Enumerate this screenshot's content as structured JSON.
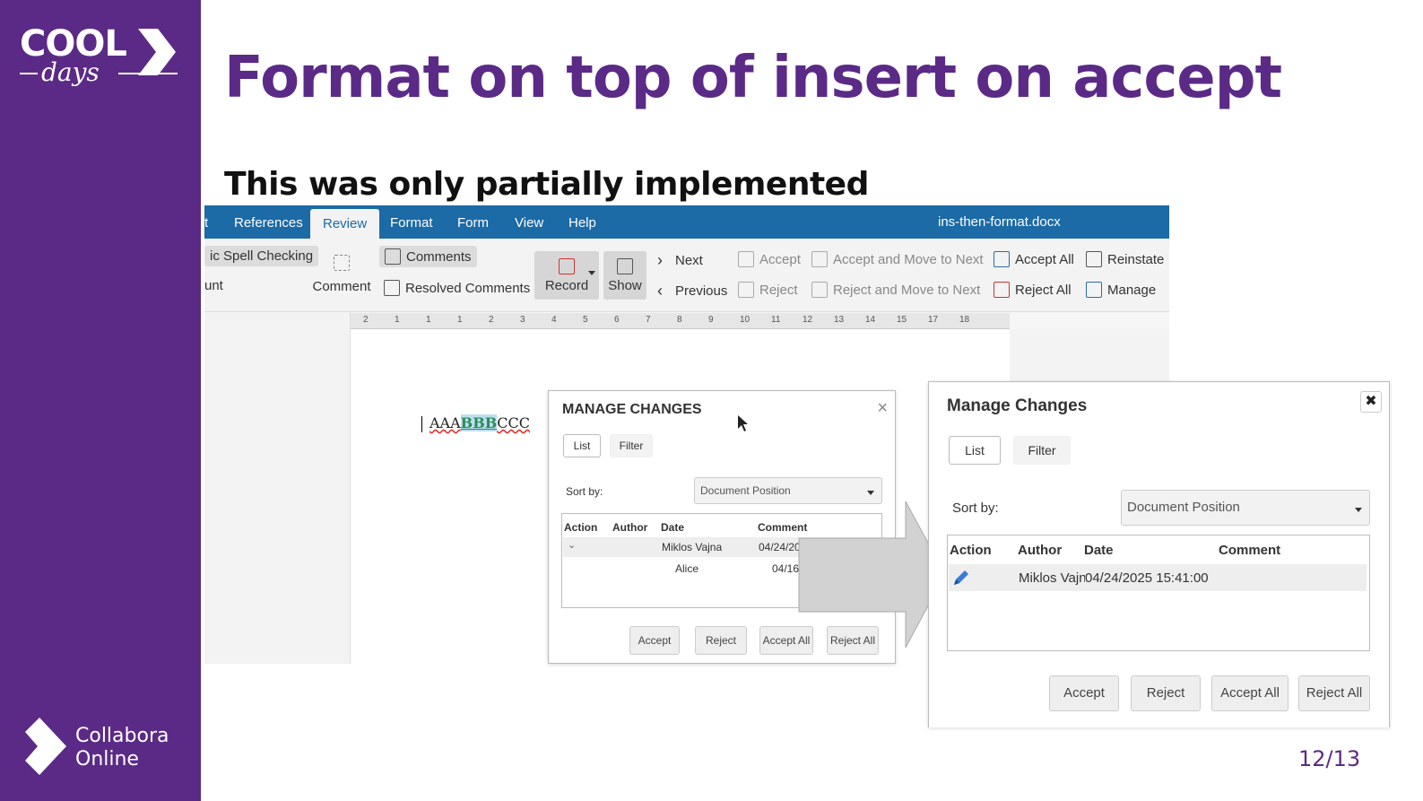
{
  "slide": {
    "title": "Format on top of insert on accept",
    "subtitle": "This was only partially implemented",
    "page_number": "12/13"
  },
  "branding": {
    "cool_logo_top": "COOL",
    "cool_logo_bottom": "days",
    "collabora_logo": "Collabora\nOnline"
  },
  "colors": {
    "purple": "#5b2a86",
    "tab_blue": "#1c6aa6"
  },
  "app": {
    "tabs": [
      "t",
      "References",
      "Review",
      "Format",
      "Form",
      "View",
      "Help"
    ],
    "active_tab": "Review",
    "document_name": "ins-then-format.docx",
    "ribbon": {
      "spell_checking": "ic Spell Checking",
      "word_count": "unt",
      "comment": "Comment",
      "comments": "Comments",
      "resolved_comments": "Resolved Comments",
      "record": "Record",
      "show": "Show",
      "next": "Next",
      "previous": "Previous",
      "accept": "Accept",
      "reject": "Reject",
      "accept_and_move": "Accept and Move to Next",
      "reject_and_move": "Reject and Move to Next",
      "accept_all": "Accept All",
      "reject_all": "Reject All",
      "reinstate": "Reinstate",
      "manage": "Manage"
    },
    "ruler_ticks": [
      "2",
      "1",
      "1",
      "1",
      "2",
      "3",
      "4",
      "5",
      "6",
      "7",
      "8",
      "9",
      "10",
      "11",
      "12",
      "13",
      "14",
      "15",
      "17",
      "18"
    ],
    "document_text": {
      "before": "AAA",
      "changed": "BBB",
      "after": "CCC"
    }
  },
  "dialog_small": {
    "title": "MANAGE CHANGES",
    "tab_list": "List",
    "tab_filter": "Filter",
    "sort_label": "Sort by:",
    "sort_value": "Document Position",
    "columns": [
      "Action",
      "Author",
      "Date",
      "Comment"
    ],
    "rows": [
      {
        "author": "Miklos Vajna",
        "date": "04/24/202"
      },
      {
        "author": "Alice",
        "date": "04/16/"
      }
    ],
    "buttons": [
      "Accept",
      "Reject",
      "Accept All",
      "Reject All"
    ]
  },
  "dialog_large": {
    "title": "Manage Changes",
    "tab_list": "List",
    "tab_filter": "Filter",
    "sort_label": "Sort by:",
    "sort_value": "Document Position",
    "columns": [
      "Action",
      "Author",
      "Date",
      "Comment"
    ],
    "rows": [
      {
        "action_icon": "pencil-icon",
        "author": "Miklos Vajna",
        "date": "04/24/2025 15:41:00"
      }
    ],
    "buttons": [
      "Accept",
      "Reject",
      "Accept All",
      "Reject All"
    ]
  }
}
